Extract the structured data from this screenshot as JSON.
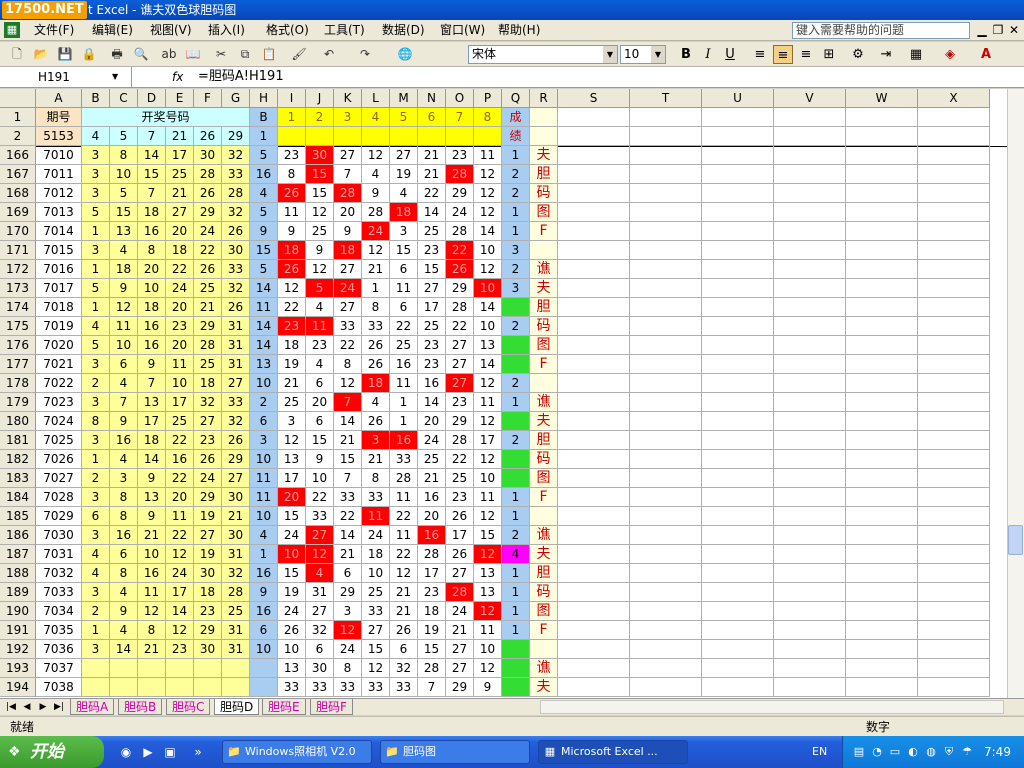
{
  "window": {
    "logo": "17500.NET",
    "title": "t Excel - 谯夫双色球胆码图"
  },
  "menu": [
    "文件(F)",
    "编辑(E)",
    "视图(V)",
    "插入(I)",
    "格式(O)",
    "工具(T)",
    "数据(D)",
    "窗口(W)",
    "帮助(H)"
  ],
  "help_box": "键入需要帮助的问题",
  "toolbar": {
    "font_name": "宋体",
    "font_size": "10"
  },
  "formula_bar": {
    "cell_ref": "H191",
    "formula": "=胆码A!H191",
    "fx": "fx"
  },
  "columns": [
    "A",
    "B",
    "C",
    "D",
    "E",
    "F",
    "G",
    "H",
    "I",
    "J",
    "K",
    "L",
    "M",
    "N",
    "O",
    "P",
    "Q",
    "R",
    "S",
    "T",
    "U",
    "V",
    "W",
    "X"
  ],
  "header_rows": {
    "row1": {
      "num": "1",
      "a": "期号",
      "bg_merged": "开奖号码",
      "h": "B",
      "i_p": [
        "1",
        "2",
        "3",
        "4",
        "5",
        "6",
        "7",
        "8"
      ],
      "q": "成",
      "q2": "绩"
    },
    "row2": {
      "num": "2",
      "a": "5153",
      "bg": [
        "4",
        "5",
        "7",
        "21",
        "26",
        "29"
      ],
      "h": "1"
    }
  },
  "rows": [
    {
      "num": "166",
      "a": "7010",
      "bg": [
        "3",
        "8",
        "14",
        "17",
        "30",
        "32"
      ],
      "h": "5",
      "ip": [
        "23",
        "30",
        "27",
        "12",
        "27",
        "21",
        "23",
        "11"
      ],
      "q": "1",
      "r": "夫"
    },
    {
      "num": "167",
      "a": "7011",
      "bg": [
        "3",
        "10",
        "15",
        "25",
        "28",
        "33"
      ],
      "h": "16",
      "ip": [
        "8",
        "15",
        "7",
        "4",
        "19",
        "21",
        "28",
        "12"
      ],
      "q": "2",
      "r": "胆"
    },
    {
      "num": "168",
      "a": "7012",
      "bg": [
        "3",
        "5",
        "7",
        "21",
        "26",
        "28"
      ],
      "h": "4",
      "ip": [
        "26",
        "15",
        "28",
        "9",
        "4",
        "22",
        "29",
        "12"
      ],
      "q": "2",
      "r": "码"
    },
    {
      "num": "169",
      "a": "7013",
      "bg": [
        "5",
        "15",
        "18",
        "27",
        "29",
        "32"
      ],
      "h": "5",
      "ip": [
        "11",
        "12",
        "20",
        "28",
        "18",
        "14",
        "24",
        "12"
      ],
      "q": "1",
      "r": "图"
    },
    {
      "num": "170",
      "a": "7014",
      "bg": [
        "1",
        "13",
        "16",
        "20",
        "24",
        "26"
      ],
      "h": "9",
      "ip": [
        "9",
        "25",
        "9",
        "24",
        "3",
        "25",
        "28",
        "14"
      ],
      "q": "1",
      "r": "F"
    },
    {
      "num": "171",
      "a": "7015",
      "bg": [
        "3",
        "4",
        "8",
        "18",
        "22",
        "30"
      ],
      "h": "15",
      "ip": [
        "18",
        "9",
        "18",
        "12",
        "15",
        "23",
        "22",
        "10"
      ],
      "q": "3",
      "r": ""
    },
    {
      "num": "172",
      "a": "7016",
      "bg": [
        "1",
        "18",
        "20",
        "22",
        "26",
        "33"
      ],
      "h": "5",
      "ip": [
        "26",
        "12",
        "27",
        "21",
        "6",
        "15",
        "26",
        "12"
      ],
      "q": "2",
      "r": "谯"
    },
    {
      "num": "173",
      "a": "7017",
      "bg": [
        "5",
        "9",
        "10",
        "24",
        "25",
        "32"
      ],
      "h": "14",
      "ip": [
        "12",
        "5",
        "24",
        "1",
        "11",
        "27",
        "29",
        "10"
      ],
      "q": "3",
      "r": "夫"
    },
    {
      "num": "174",
      "a": "7018",
      "bg": [
        "1",
        "12",
        "18",
        "20",
        "21",
        "26"
      ],
      "h": "11",
      "ip": [
        "22",
        "4",
        "27",
        "8",
        "6",
        "17",
        "28",
        "14"
      ],
      "q": "",
      "r": "胆"
    },
    {
      "num": "175",
      "a": "7019",
      "bg": [
        "4",
        "11",
        "16",
        "23",
        "29",
        "31"
      ],
      "h": "14",
      "ip": [
        "23",
        "11",
        "33",
        "33",
        "22",
        "25",
        "22",
        "10"
      ],
      "q": "2",
      "r": "码"
    },
    {
      "num": "176",
      "a": "7020",
      "bg": [
        "5",
        "10",
        "16",
        "20",
        "28",
        "31"
      ],
      "h": "14",
      "ip": [
        "18",
        "23",
        "22",
        "26",
        "25",
        "23",
        "27",
        "13"
      ],
      "q": "",
      "r": "图"
    },
    {
      "num": "177",
      "a": "7021",
      "bg": [
        "3",
        "6",
        "9",
        "11",
        "25",
        "31"
      ],
      "h": "13",
      "ip": [
        "19",
        "4",
        "8",
        "26",
        "16",
        "23",
        "27",
        "14"
      ],
      "q": "",
      "r": "F"
    },
    {
      "num": "178",
      "a": "7022",
      "bg": [
        "2",
        "4",
        "7",
        "10",
        "18",
        "27"
      ],
      "h": "10",
      "ip": [
        "21",
        "6",
        "12",
        "18",
        "11",
        "16",
        "27",
        "12"
      ],
      "q": "2",
      "r": ""
    },
    {
      "num": "179",
      "a": "7023",
      "bg": [
        "3",
        "7",
        "13",
        "17",
        "32",
        "33"
      ],
      "h": "2",
      "ip": [
        "25",
        "20",
        "7",
        "4",
        "1",
        "14",
        "23",
        "11"
      ],
      "q": "1",
      "r": "谯"
    },
    {
      "num": "180",
      "a": "7024",
      "bg": [
        "8",
        "9",
        "17",
        "25",
        "27",
        "32"
      ],
      "h": "6",
      "ip": [
        "3",
        "6",
        "14",
        "26",
        "1",
        "20",
        "29",
        "12"
      ],
      "q": "",
      "r": "夫"
    },
    {
      "num": "181",
      "a": "7025",
      "bg": [
        "3",
        "16",
        "18",
        "22",
        "23",
        "26"
      ],
      "h": "3",
      "ip": [
        "12",
        "15",
        "21",
        "3",
        "16",
        "24",
        "28",
        "17"
      ],
      "q": "2",
      "r": "胆"
    },
    {
      "num": "182",
      "a": "7026",
      "bg": [
        "1",
        "4",
        "14",
        "16",
        "26",
        "29"
      ],
      "h": "10",
      "ip": [
        "13",
        "9",
        "15",
        "21",
        "33",
        "25",
        "22",
        "12"
      ],
      "q": "",
      "r": "码"
    },
    {
      "num": "183",
      "a": "7027",
      "bg": [
        "2",
        "3",
        "9",
        "22",
        "24",
        "27"
      ],
      "h": "11",
      "ip": [
        "17",
        "10",
        "7",
        "8",
        "28",
        "21",
        "25",
        "10"
      ],
      "q": "",
      "r": "图"
    },
    {
      "num": "184",
      "a": "7028",
      "bg": [
        "3",
        "8",
        "13",
        "20",
        "29",
        "30"
      ],
      "h": "11",
      "ip": [
        "20",
        "22",
        "33",
        "33",
        "11",
        "16",
        "23",
        "11"
      ],
      "q": "1",
      "r": "F"
    },
    {
      "num": "185",
      "a": "7029",
      "bg": [
        "6",
        "8",
        "9",
        "11",
        "19",
        "21"
      ],
      "h": "10",
      "ip": [
        "15",
        "33",
        "22",
        "11",
        "22",
        "20",
        "26",
        "12"
      ],
      "q": "1",
      "r": ""
    },
    {
      "num": "186",
      "a": "7030",
      "bg": [
        "3",
        "16",
        "21",
        "22",
        "27",
        "30"
      ],
      "h": "4",
      "ip": [
        "24",
        "27",
        "14",
        "24",
        "11",
        "16",
        "17",
        "15"
      ],
      "q": "2",
      "r": "谯"
    },
    {
      "num": "187",
      "a": "7031",
      "bg": [
        "4",
        "6",
        "10",
        "12",
        "19",
        "31"
      ],
      "h": "1",
      "ip": [
        "10",
        "12",
        "21",
        "18",
        "22",
        "28",
        "26",
        "12"
      ],
      "q": "4",
      "r": "夫"
    },
    {
      "num": "188",
      "a": "7032",
      "bg": [
        "4",
        "8",
        "16",
        "24",
        "30",
        "32"
      ],
      "h": "16",
      "ip": [
        "15",
        "4",
        "6",
        "10",
        "12",
        "17",
        "27",
        "13"
      ],
      "q": "1",
      "r": "胆"
    },
    {
      "num": "189",
      "a": "7033",
      "bg": [
        "3",
        "4",
        "11",
        "17",
        "18",
        "28"
      ],
      "h": "9",
      "ip": [
        "19",
        "31",
        "29",
        "25",
        "21",
        "23",
        "28",
        "13"
      ],
      "q": "1",
      "r": "码"
    },
    {
      "num": "190",
      "a": "7034",
      "bg": [
        "2",
        "9",
        "12",
        "14",
        "23",
        "25"
      ],
      "h": "16",
      "ip": [
        "24",
        "27",
        "3",
        "33",
        "21",
        "18",
        "24",
        "12"
      ],
      "q": "1",
      "r": "图"
    },
    {
      "num": "191",
      "a": "7035",
      "bg": [
        "1",
        "4",
        "8",
        "12",
        "29",
        "31"
      ],
      "h": "6",
      "ip": [
        "26",
        "32",
        "12",
        "27",
        "26",
        "19",
        "21",
        "11"
      ],
      "q": "1",
      "r": "F"
    },
    {
      "num": "192",
      "a": "7036",
      "bg": [
        "3",
        "14",
        "21",
        "23",
        "30",
        "31"
      ],
      "h": "10",
      "ip": [
        "10",
        "6",
        "24",
        "15",
        "6",
        "15",
        "27",
        "10"
      ],
      "q": "",
      "r": ""
    },
    {
      "num": "193",
      "a": "7037",
      "bg": [
        "",
        "",
        "",
        "",
        "",
        ""
      ],
      "h": "",
      "ip": [
        "13",
        "30",
        "8",
        "12",
        "32",
        "28",
        "27",
        "12"
      ],
      "q": "",
      "r": "谯"
    },
    {
      "num": "194",
      "a": "7038",
      "bg": [
        "",
        "",
        "",
        "",
        "",
        ""
      ],
      "h": "",
      "ip": [
        "33",
        "33",
        "33",
        "33",
        "33",
        "7",
        "29",
        "9"
      ],
      "q": "",
      "r": "夫"
    }
  ],
  "sheet_tabs": [
    "胆码A",
    "胆码B",
    "胆码C",
    "胆码D",
    "胆码E",
    "胆码F"
  ],
  "active_tab": "胆码D",
  "status": {
    "ready": "就绪",
    "num": "数字"
  },
  "taskbar": {
    "start": "开始",
    "tasks": [
      "Windows照相机 V2.0",
      "胆码图",
      "Microsoft Excel ..."
    ],
    "lang": "EN",
    "clock": "7:49"
  }
}
